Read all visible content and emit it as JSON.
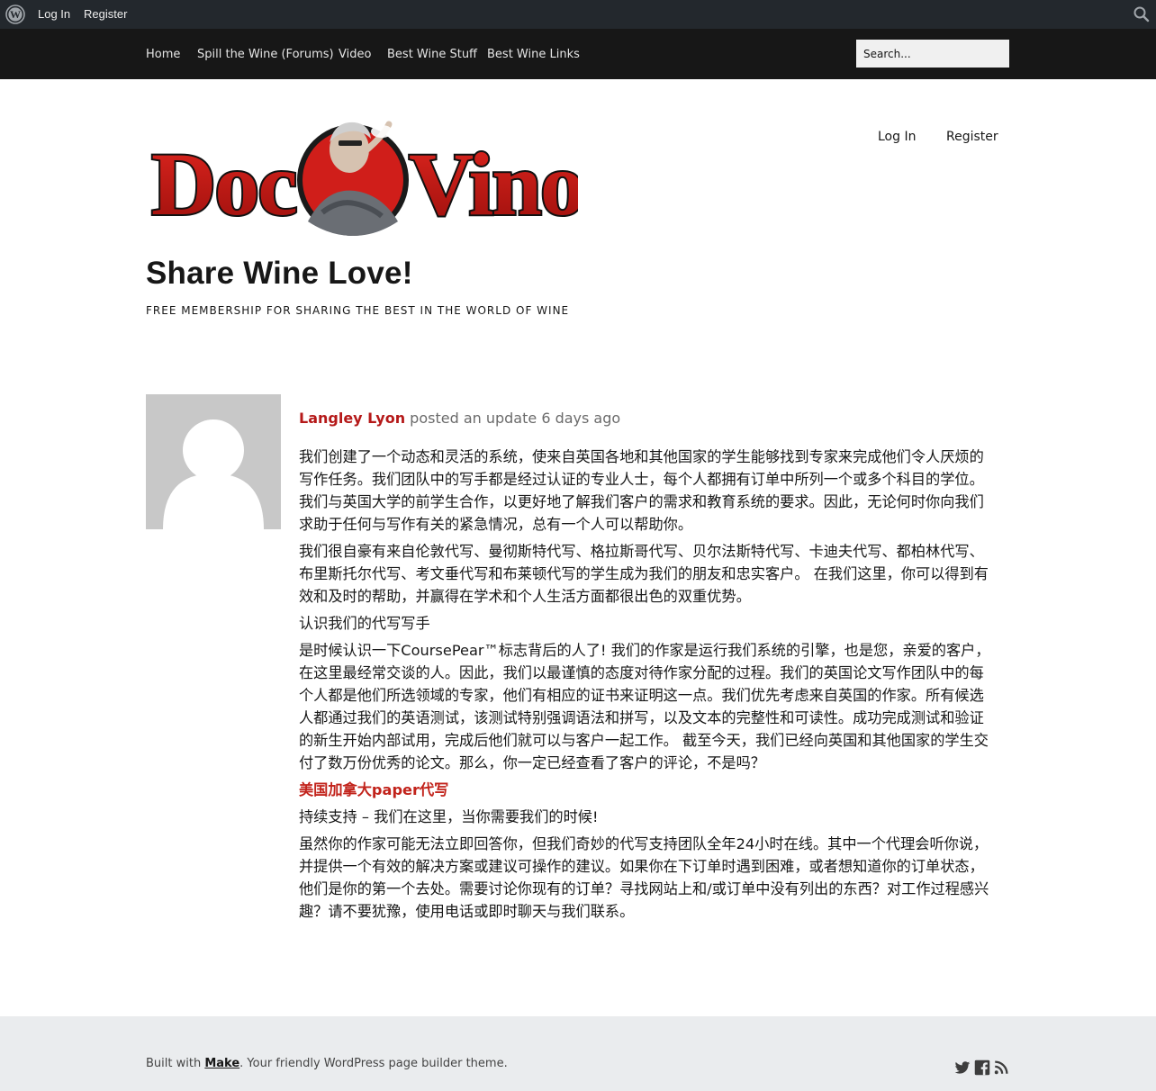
{
  "admin_bar": {
    "login": "Log In",
    "register": "Register"
  },
  "menu": {
    "items": [
      "Home",
      "Spill the Wine (Forums)",
      "Video",
      "Best Wine Stuff",
      "Best Wine Links"
    ],
    "search_placeholder": "Search..."
  },
  "header": {
    "logo_text": "DocVino",
    "login": "Log In",
    "register": "Register",
    "site_title": "Share Wine Love!",
    "tagline": "FREE MEMBERSHIP FOR SHARING THE BEST IN THE WORLD OF WINE"
  },
  "activity": {
    "author": "Langley Lyon",
    "action": " posted an update 6 days ago",
    "paragraphs": [
      "我们创建了一个动态和灵活的系统，使来自英国各地和其他国家的学生能够找到专家来完成他们令人厌烦的写作任务。我们团队中的写手都是经过认证的专业人士，每个人都拥有订单中所列一个或多个科目的学位。我们与英国大学的前学生合作，以更好地了解我们客户的需求和教育系统的要求。因此，无论何时你向我们求助于任何与写作有关的紧急情况，总有一个人可以帮助你。",
      "我们很自豪有来自伦敦代写、曼彻斯特代写、格拉斯哥代写、贝尔法斯特代写、卡迪夫代写、都柏林代写、布里斯托尔代写、考文垂代写和布莱顿代写的学生成为我们的朋友和忠实客户。 在我们这里，你可以得到有效和及时的帮助，并赢得在学术和个人生活方面都很出色的双重优势。",
      "认识我们的代写写手",
      "是时候认识一下CoursePear™标志背后的人了! 我们的作家是运行我们系统的引擎，也是您，亲爱的客户，在这里最经常交谈的人。因此，我们以最谨慎的态度对待作家分配的过程。我们的英国论文写作团队中的每个人都是他们所选领域的专家，他们有相应的证书来证明这一点。我们优先考虑来自英国的作家。所有候选人都通过我们的英语测试，该测试特别强调语法和拼写，以及文本的完整性和可读性。成功完成测试和验证的新生开始内部试用，完成后他们就可以与客户一起工作。 截至今天，我们已经向英国和其他国家的学生交付了数万份优秀的论文。那么，你一定已经查看了客户的评论，不是吗？"
    ],
    "link": "美国加拿大paper代写",
    "paragraphs2": [
      "持续支持 – 我们在这里，当你需要我们的时候!",
      "虽然你的作家可能无法立即回答你，但我们奇妙的代写支持团队全年24小时在线。其中一个代理会听你说，并提供一个有效的解决方案或建议可操作的建议。如果你在下订单时遇到困难，或者想知道你的订单状态，他们是你的第一个去处。需要讨论你现有的订单？寻找网站上和/或订单中没有列出的东西？对工作过程感兴趣？请不要犹豫，使用电话或即时聊天与我们联系。"
    ]
  },
  "footer": {
    "built_with": "Built with ",
    "make": "Make",
    "suffix": ". Your friendly WordPress page builder theme."
  },
  "icons": {
    "wordpress": "wordpress-icon",
    "search": "search-icon",
    "twitter": "twitter-icon",
    "facebook": "facebook-icon",
    "rss": "rss-icon"
  },
  "colors": {
    "accent_red": "#b51919",
    "admin_bar": "#23282d",
    "menu_bar": "#171717",
    "footer_bg": "#eaecee"
  }
}
